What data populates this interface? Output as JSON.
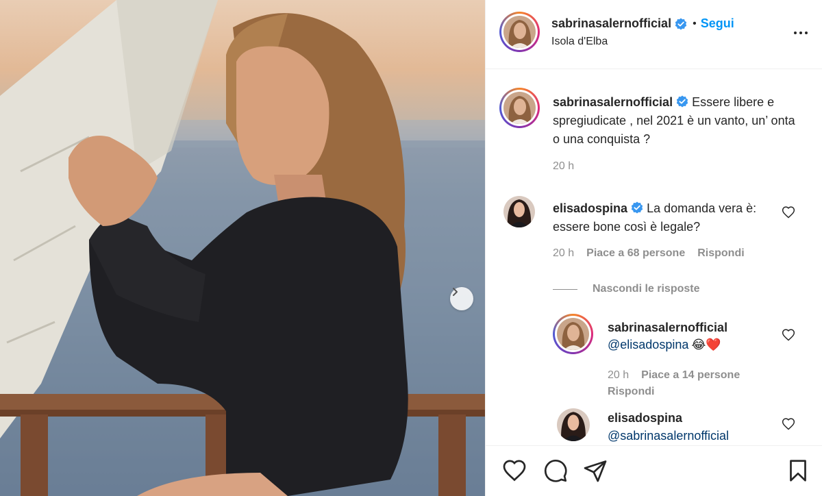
{
  "photo": {
    "next_icon": "chevron-right-icon"
  },
  "header": {
    "username": "sabrinasalernofficial",
    "separator": "•",
    "follow_label": "Segui",
    "location": "Isola d'Elba",
    "more_icon": "more-horizontal-icon"
  },
  "caption": {
    "username": "sabrinasalernofficial",
    "text": "Essere libere e spregiudicate , nel 2021 è un vanto, un’ onta o una conquista ?",
    "time": "20 h"
  },
  "comments": [
    {
      "username": "elisadospina",
      "text": "La domanda vera è: essere bone così è legale?",
      "time": "20 h",
      "likes": "Piace a 68 persone",
      "reply_label": "Rispondi"
    }
  ],
  "replies_toggle": "Nascondi le risposte",
  "replies": [
    {
      "username": "sabrinasalernofficial",
      "mention": "@elisadospina",
      "emojis": "😂❤️",
      "time": "20 h",
      "likes": "Piace a 14 persone",
      "reply_label": "Rispondi"
    },
    {
      "username": "elisadospina",
      "mention": "@sabrinasalernofficial"
    }
  ],
  "actions": {
    "like_icon": "heart-icon",
    "comment_icon": "comment-icon",
    "share_icon": "send-icon",
    "save_icon": "bookmark-icon"
  },
  "colors": {
    "link": "#0095f6",
    "verified": "#3897f0",
    "secondary_text": "#8e8e8e"
  }
}
